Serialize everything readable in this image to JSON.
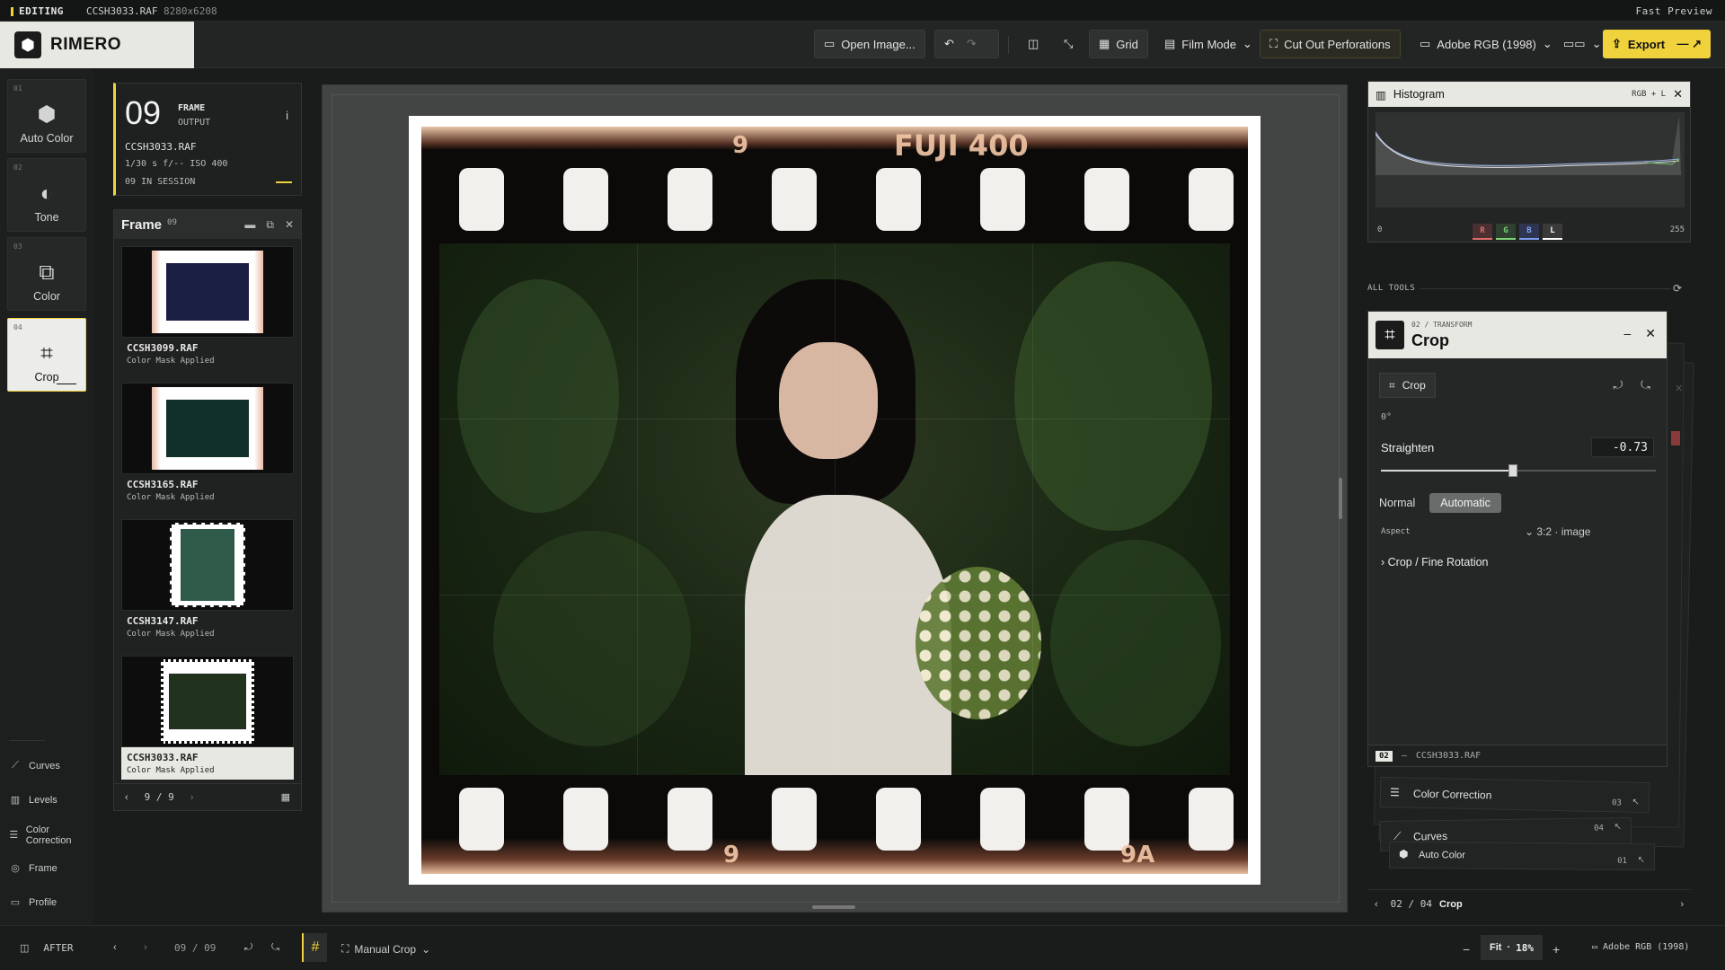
{
  "topbar": {
    "mode": "EDITING",
    "filename": "CCSH3033.RAF",
    "dimensions": "8280x6208",
    "preview": "Fast Preview"
  },
  "app": {
    "name": "RIMERO"
  },
  "toolbar": {
    "open_image": "Open Image...",
    "grid": "Grid",
    "film_mode": "Film Mode",
    "cut_perforations": "Cut Out Perforations",
    "color_space": "Adobe RGB (1998)",
    "export": "Export"
  },
  "tools": [
    {
      "num": "01",
      "label": "Auto Color"
    },
    {
      "num": "02",
      "label": "Tone"
    },
    {
      "num": "03",
      "label": "Color"
    },
    {
      "num": "04",
      "label": "Crop"
    }
  ],
  "left_nav": [
    "Curves",
    "Levels",
    "Color Correction",
    "Frame",
    "Profile"
  ],
  "output": {
    "frame_num": "09",
    "frame_label": "FRAME",
    "output_label": "OUTPUT",
    "file": "CCSH3033.RAF",
    "exposure": "1/30 s  f/--  ISO 400",
    "session": "09 IN SESSION"
  },
  "frame_panel": {
    "title": "Frame",
    "count": "09",
    "items": [
      {
        "name": "CCSH3099.RAF",
        "status": "Color Mask Applied"
      },
      {
        "name": "CCSH3165.RAF",
        "status": "Color Mask Applied"
      },
      {
        "name": "CCSH3147.RAF",
        "status": "Color Mask Applied"
      },
      {
        "name": "CCSH3033.RAF",
        "status": "Color Mask Applied"
      }
    ],
    "pager": "9 / 9"
  },
  "film": {
    "top_num": "9",
    "brand": "FUJI 400",
    "bottom_num": "9",
    "bottom_num2": "9A"
  },
  "histogram": {
    "title": "Histogram",
    "mode": "RGB + L",
    "min": "0",
    "max": "255",
    "channels": [
      "R",
      "G",
      "B",
      "L"
    ]
  },
  "all_tools": "ALL TOOLS",
  "crop_panel": {
    "sub": "02 / TRANSFORM",
    "title": "Crop",
    "crop_btn": "Crop",
    "angle": "0°",
    "straighten_label": "Straighten",
    "straighten_value": "-0.73",
    "straighten_fraction": 0.48,
    "mode_normal": "Normal",
    "mode_auto": "Automatic",
    "aspect_label": "Aspect",
    "aspect_value": "3:2 · image",
    "fine": "Crop / Fine Rotation",
    "foot_num": "02",
    "foot_file": "CCSH3033.RAF"
  },
  "stack": [
    {
      "label": "Color Correction",
      "num": "03"
    },
    {
      "label": "Curves",
      "num": "04"
    },
    {
      "label": "Auto Color",
      "num": "01"
    }
  ],
  "right_nav": {
    "pos": "02 / 04",
    "label": "Crop"
  },
  "bottom": {
    "after": "AFTER",
    "frame": "09 / 09",
    "crop_mode": "Manual Crop",
    "fit": "Fit",
    "zoom": "18%",
    "profile": "Adobe RGB (1998)"
  },
  "colors": {
    "accent": "#f0d23c",
    "bg": "#1a1b1b",
    "panel_light": "#e8e8e3"
  }
}
